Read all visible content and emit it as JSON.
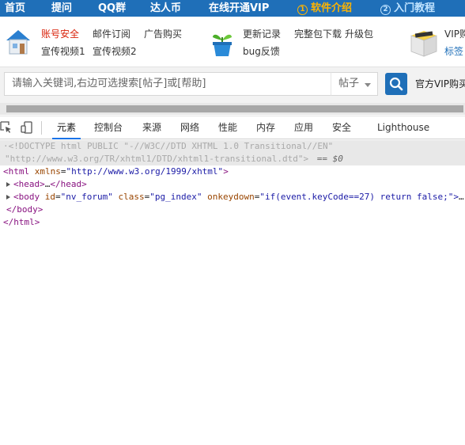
{
  "nav": {
    "items": [
      {
        "label": "首页"
      },
      {
        "label": "提问"
      },
      {
        "label": "QQ群"
      },
      {
        "label": "达人币"
      },
      {
        "label": "在线开通VIP"
      },
      {
        "num": "1",
        "label": "软件介绍"
      },
      {
        "num": "2",
        "label": "入门教程"
      }
    ]
  },
  "links": {
    "account_security": "账号安全",
    "mail_subscribe": "邮件订阅",
    "ad_purchase": "广告购买",
    "promo_video_1": "宣传视频1",
    "promo_video_2": "宣传视频2",
    "changelog": "更新记录",
    "full_download": "完整包下载",
    "upgrade_pack": "升级包",
    "bug_feedback": "bug反馈",
    "vip_right_1": "VIP购",
    "vip_right_2": "标签"
  },
  "search": {
    "placeholder": "请输入关键词,右边可选搜索[帖子]或[帮助]",
    "scope": "帖子",
    "vip_buy": "官方VIP购买"
  },
  "devtools": {
    "tabs": [
      "元素",
      "控制台",
      "来源",
      "网络",
      "性能",
      "内存",
      "应用",
      "安全",
      "Lighthouse"
    ],
    "active_tab": "元素"
  },
  "source": {
    "doctype_line1": "<!DOCTYPE html PUBLIC \"-//W3C//DTD XHTML 1.0 Transitional//EN\"",
    "doctype_line2": "\"http://www.w3.org/TR/xhtml1/DTD/xhtml1-transitional.dtd\">",
    "doctype_marker": "== $0",
    "html_open_tag": "<html",
    "html_attr_name": "xmlns",
    "html_attr_value": "\"http://www.w3.org/1999/xhtml\"",
    "head_tag": "<head>",
    "head_ellipsis": "…",
    "head_close": "</head>",
    "body_open": "<body",
    "body_id_name": "id",
    "body_id_value": "\"nv_forum\"",
    "body_class_name": "class",
    "body_class_value": "\"pg_index\"",
    "body_event_name": "onkeydown",
    "body_event_value": "\"if(event.keyCode==27) return false;\">",
    "body_ellipsis": "…",
    "body_close": "</body>",
    "html_close": "</html>"
  },
  "colors": {
    "nav_bg": "#1f6fb8",
    "nav_highlight": "#ffb400",
    "devtools_accent": "#1a73e8",
    "tag": "#881280",
    "attr": "#994500",
    "attr_value": "#1a1aa6"
  }
}
